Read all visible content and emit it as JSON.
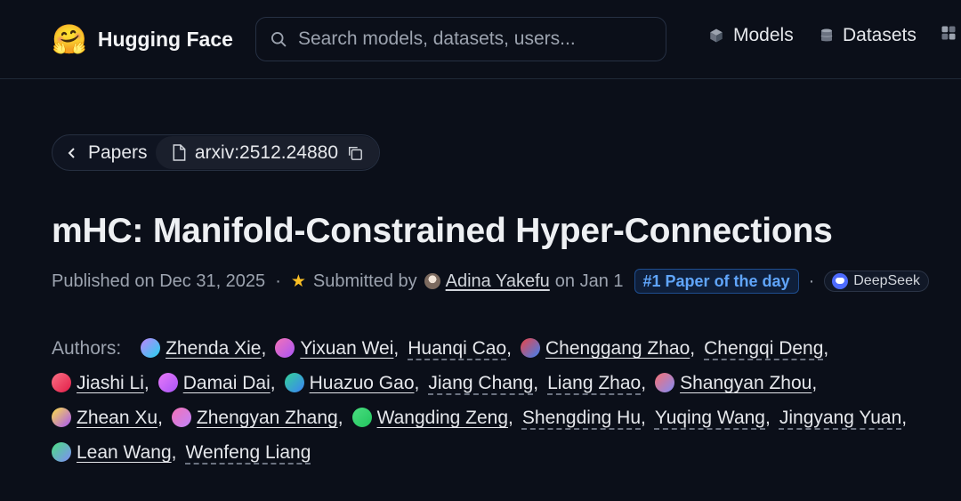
{
  "header": {
    "logo_emoji": "🤗",
    "logo_text": "Hugging Face",
    "search_placeholder": "Search models, datasets, users...",
    "nav": [
      {
        "label": "Models",
        "icon": "cube-icon"
      },
      {
        "label": "Datasets",
        "icon": "database-icon"
      },
      {
        "label": "",
        "icon": "grid-icon"
      }
    ]
  },
  "breadcrumb": {
    "back_label": "Papers",
    "paper_id": "arxiv:2512.24880"
  },
  "paper": {
    "title": "mHC: Manifold-Constrained Hyper-Connections",
    "published": "Published on Dec 31, 2025",
    "submitted_by_label": "Submitted by",
    "submitter": "Adina Yakefu",
    "submitted_date": "on Jan 1",
    "badge": "#1 Paper of the day",
    "org": "DeepSeek"
  },
  "authors_label": "Authors:",
  "authors": [
    {
      "name": "Zhenda Xie",
      "avatar": [
        "#c084fc",
        "#22d3ee"
      ],
      "linked": true
    },
    {
      "name": "Yixuan Wei",
      "avatar": [
        "#f472b6",
        "#a855f7"
      ],
      "linked": true
    },
    {
      "name": "Huanqi Cao",
      "avatar": null,
      "linked": false
    },
    {
      "name": "Chenggang Zhao",
      "avatar": [
        "#ef4444",
        "#3b82f6"
      ],
      "linked": true
    },
    {
      "name": "Chengqi Deng",
      "avatar": null,
      "linked": false
    },
    {
      "name": "Jiashi Li",
      "avatar": [
        "#fb7185",
        "#e11d48"
      ],
      "linked": true
    },
    {
      "name": "Damai Dai",
      "avatar": [
        "#e879f9",
        "#a855f7"
      ],
      "linked": true
    },
    {
      "name": "Huazuo Gao",
      "avatar": [
        "#34d399",
        "#3b82f6"
      ],
      "linked": true
    },
    {
      "name": "Jiang Chang",
      "avatar": null,
      "linked": false
    },
    {
      "name": "Liang Zhao",
      "avatar": null,
      "linked": false
    },
    {
      "name": "Shangyan Zhou",
      "avatar": [
        "#f87171",
        "#818cf8"
      ],
      "linked": true
    },
    {
      "name": "Zhean Xu",
      "avatar": [
        "#fde047",
        "#a855f7"
      ],
      "linked": true
    },
    {
      "name": "Zhengyan Zhang",
      "avatar": [
        "#f472b6",
        "#c084fc"
      ],
      "linked": true
    },
    {
      "name": "Wangding Zeng",
      "avatar": [
        "#4ade80",
        "#22c55e"
      ],
      "linked": true
    },
    {
      "name": "Shengding Hu",
      "avatar": null,
      "linked": false
    },
    {
      "name": "Yuqing Wang",
      "avatar": null,
      "linked": false
    },
    {
      "name": "Jingyang Yuan",
      "avatar": null,
      "linked": false
    },
    {
      "name": "Lean Wang",
      "avatar": [
        "#4ade80",
        "#818cf8"
      ],
      "linked": true
    },
    {
      "name": "Wenfeng Liang",
      "avatar": null,
      "linked": false
    }
  ]
}
